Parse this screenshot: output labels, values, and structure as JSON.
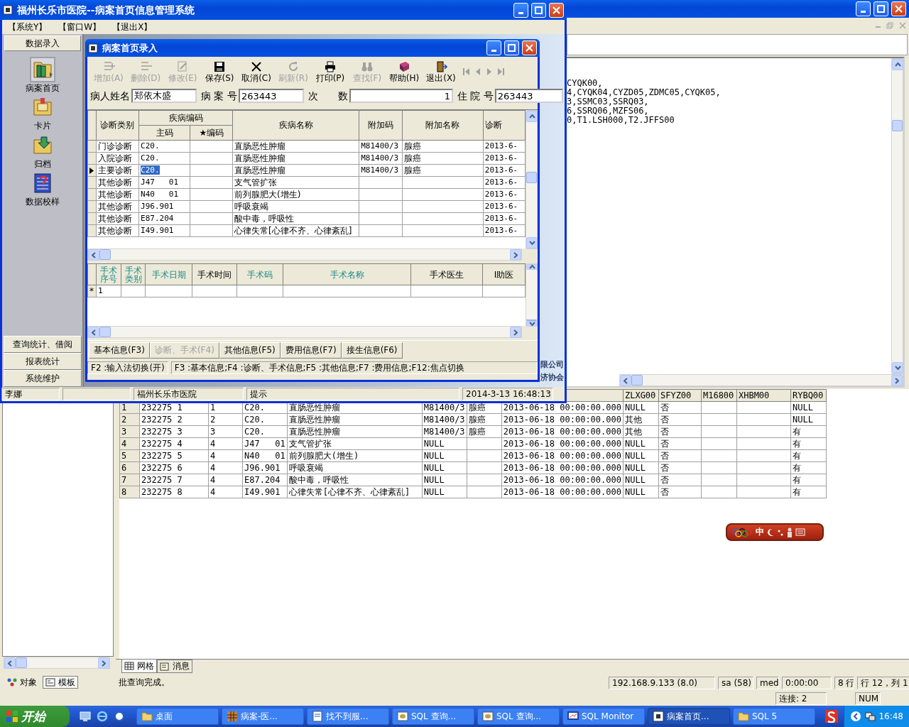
{
  "sql_window": {
    "query_lines": [
      "CYQK00,",
      "4,CYQK04,CYZD05,ZDMC05,CYQK05,",
      "3,SSMC03,SSRQ03,",
      "6,SSRQ06,MZFS06,",
      "0,T1.LSH000,T2.JFFS00"
    ],
    "results": {
      "columns": [
        "ZLXG00",
        "SFYZ00",
        "M16800",
        "XHBM00",
        "RYBQ00"
      ],
      "rows": [
        {
          "no": "1",
          "id": "232275 1",
          "type": "1",
          "code": "C20.",
          "name": "直肠恶性肿瘤",
          "extra_code": "M81400/3",
          "extra_name": "腺癌",
          "date": "2013-06-18 00:00:00.000",
          "zlxg": "NULL",
          "sfyz": "否",
          "rybq": "NULL"
        },
        {
          "no": "2",
          "id": "232275 2",
          "type": "2",
          "code": "C20.",
          "name": "直肠恶性肿瘤",
          "extra_code": "M81400/3",
          "extra_name": "腺癌",
          "date": "2013-06-18 00:00:00.000",
          "zlxg": "其他",
          "sfyz": "否",
          "rybq": "NULL"
        },
        {
          "no": "3",
          "id": "232275 3",
          "type": "3",
          "code": "C20.",
          "name": "直肠恶性肿瘤",
          "extra_code": "M81400/3",
          "extra_name": "腺癌",
          "date": "2013-06-18 00:00:00.000",
          "zlxg": "其他",
          "sfyz": "否",
          "rybq": "有"
        },
        {
          "no": "4",
          "id": "232275 4",
          "type": "4",
          "code": "J47   01",
          "name": "支气管扩张",
          "extra_code": "NULL",
          "date": "2013-06-18 00:00:00.000",
          "zlxg": "NULL",
          "sfyz": "否",
          "rybq": "有"
        },
        {
          "no": "5",
          "id": "232275 5",
          "type": "4",
          "code": "N40   01",
          "name": "前列腺肥大(增生)",
          "extra_code": "NULL",
          "date": "2013-06-18 00:00:00.000",
          "zlxg": "NULL",
          "sfyz": "否",
          "rybq": "有"
        },
        {
          "no": "6",
          "id": "232275 6",
          "type": "4",
          "code": "J96.901",
          "name": "呼吸衰竭",
          "extra_code": "NULL",
          "date": "2013-06-18 00:00:00.000",
          "zlxg": "NULL",
          "sfyz": "否",
          "rybq": "有"
        },
        {
          "no": "7",
          "id": "232275 7",
          "type": "4",
          "code": "E87.204",
          "name": "酸中毒，呼吸性",
          "extra_code": "NULL",
          "date": "2013-06-18 00:00:00.000",
          "zlxg": "NULL",
          "sfyz": "否",
          "rybq": "有"
        },
        {
          "no": "8",
          "id": "232275 8",
          "type": "4",
          "code": "I49.901",
          "name": "心律失常[心律不齐、心律紊乱]",
          "extra_code": "NULL",
          "date": "2013-06-18 00:00:00.000",
          "zlxg": "NULL",
          "sfyz": "否",
          "rybq": "有"
        }
      ]
    },
    "result_tabs": [
      {
        "label": "网格",
        "kind": "grid",
        "selected": true
      },
      {
        "label": "消息",
        "kind": "message",
        "selected": false
      }
    ],
    "object_tabs": [
      {
        "label": "对象",
        "kind": "objects",
        "selected": true
      },
      {
        "label": "模板",
        "kind": "templates",
        "selected": false
      }
    ],
    "status_bar": [
      "批查询完成。",
      "192.168.9.133 (8.0)",
      "sa (58)",
      "med",
      "0:00:00",
      "8 行",
      "行 12，列 1"
    ],
    "status_bar_2": [
      "连接: 2",
      "NUM"
    ]
  },
  "app_window": {
    "title": "福州长乐市医院--病案首页信息管理系统",
    "menu": [
      "【系统Y】",
      "【窗口W】",
      "【退出X】"
    ],
    "sidebar": {
      "header": "数据录入",
      "items": [
        {
          "label": "病案首页",
          "kind": "record"
        },
        {
          "label": "卡片",
          "kind": "card"
        },
        {
          "label": "归档",
          "kind": "archive"
        },
        {
          "label": "数据校样",
          "kind": "check"
        }
      ],
      "buttons": [
        "查询统计、借阅",
        "报表统计",
        "系统维护"
      ]
    },
    "background_texts": [
      "限公司",
      "济协会"
    ],
    "status_bar": [
      "李娜",
      "福州长乐市医院",
      "提示",
      "2014-3-13 16:48:13"
    ]
  },
  "form_window": {
    "title": "病案首页录入",
    "toolbar": [
      {
        "label": "增加(A)",
        "kind": "add",
        "disabled": true
      },
      {
        "label": "删除(D)",
        "kind": "delete",
        "disabled": true
      },
      {
        "label": "修改(E)",
        "kind": "edit",
        "disabled": true
      },
      {
        "label": "保存(S)",
        "kind": "save",
        "disabled": false
      },
      {
        "label": "取消(C)",
        "kind": "cancel",
        "disabled": false
      },
      {
        "label": "刷新(R)",
        "kind": "refresh",
        "disabled": true
      },
      {
        "label": "打印(P)",
        "kind": "print",
        "disabled": false
      },
      {
        "label": "查找(F)",
        "kind": "find",
        "disabled": true
      },
      {
        "label": "帮助(H)",
        "kind": "help",
        "disabled": false
      },
      {
        "label": "退出(X)",
        "kind": "exit",
        "disabled": false
      }
    ],
    "fields": [
      {
        "label": "病人姓名",
        "value": "郑依木盛"
      },
      {
        "label": "病 案 号",
        "value": "263443"
      },
      {
        "label": "次　　数",
        "value": "1"
      },
      {
        "label": "住 院 号",
        "value": "263443"
      }
    ],
    "diagnoses": {
      "headers": {
        "type": "诊断类别",
        "code_group": "疾病编码",
        "main_code": "主码",
        "star_code": "★编码",
        "name": "疾病名称",
        "extra_code": "附加码",
        "extra_name": "附加名称",
        "date": "诊断"
      },
      "rows": [
        {
          "type": "门诊诊断",
          "code": "C20.",
          "name": "直肠恶性肿瘤",
          "extra_code": "M81400/3",
          "extra_name": "腺癌",
          "date": "2013-6-",
          "current": false
        },
        {
          "type": "入院诊断",
          "code": "C20.",
          "name": "直肠恶性肿瘤",
          "extra_code": "M81400/3",
          "extra_name": "腺癌",
          "date": "2013-6-",
          "current": false
        },
        {
          "type": "主要诊断",
          "code": "C20.",
          "name": "直肠恶性肿瘤",
          "extra_code": "M81400/3",
          "extra_name": "腺癌",
          "date": "2013-6-",
          "current": true
        },
        {
          "type": "其他诊断",
          "code": "J47   01",
          "name": "支气管扩张",
          "date": "2013-6-",
          "current": false
        },
        {
          "type": "其他诊断",
          "code": "N40   01",
          "name": "前列腺肥大(增生)",
          "date": "2013-6-",
          "current": false
        },
        {
          "type": "其他诊断",
          "code": "J96.901",
          "name": "呼吸衰竭",
          "date": "2013-6-",
          "current": false
        },
        {
          "type": "其他诊断",
          "code": "E87.204",
          "name": "酸中毒，呼吸性",
          "date": "2013-6-",
          "current": false
        },
        {
          "type": "其他诊断",
          "code": "I49.901",
          "name": "心律失常[心律不齐、心律紊乱]",
          "date": "2013-6-",
          "current": false
        }
      ]
    },
    "operations": {
      "columns": [
        {
          "label": "手术序号",
          "required": true
        },
        {
          "label": "手术类别",
          "required": true
        },
        {
          "label": "手术日期",
          "required": true
        },
        {
          "label": "手术时间",
          "required": false
        },
        {
          "label": "手术码",
          "required": true
        },
        {
          "label": "手术名称",
          "required": true
        },
        {
          "label": "手术医生",
          "required": false
        },
        {
          "label": "I助医",
          "required": false
        }
      ],
      "rows": [
        {
          "marker": "*",
          "no": "1"
        }
      ]
    },
    "tabs": [
      {
        "label": "基本信息(F3)",
        "selected": false
      },
      {
        "label": "诊断、手术(F4)",
        "selected": true
      },
      {
        "label": "其他信息(F5)",
        "selected": false
      },
      {
        "label": "费用信息(F7)",
        "selected": false
      },
      {
        "label": "接生信息(F6)",
        "selected": false
      }
    ],
    "help": [
      "F2 :输入法切换(开)",
      "F3 :基本信息;F4 :诊断、手术信息;F5 :其他信息;F7 :费用信息;F12:焦点切换"
    ]
  },
  "ime_bar": {
    "mode": "中"
  },
  "taskbar": {
    "start": "开始",
    "tasks": [
      {
        "label": "桌面",
        "kind": "folder",
        "selected": false
      },
      {
        "label": "病案-医...",
        "kind": "app",
        "selected": false
      },
      {
        "label": "找不到服...",
        "kind": "browser",
        "selected": false
      },
      {
        "label": "SQL 查询...",
        "kind": "sql",
        "selected": false
      },
      {
        "label": "SQL 查询...",
        "kind": "sql",
        "selected": false
      },
      {
        "label": "SQL Monitor",
        "kind": "monitor",
        "selected": false
      },
      {
        "label": "病案首页...",
        "kind": "window",
        "selected": true
      },
      {
        "label": "SQL 5",
        "kind": "folder",
        "selected": false
      }
    ],
    "clock": "16:48"
  }
}
